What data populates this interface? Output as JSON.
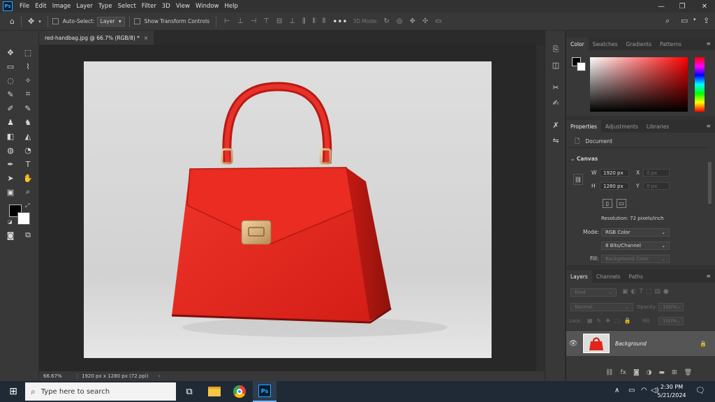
{
  "app": {
    "logo": "Ps"
  },
  "menu": [
    "File",
    "Edit",
    "Image",
    "Layer",
    "Type",
    "Select",
    "Filter",
    "3D",
    "View",
    "Window",
    "Help"
  ],
  "window_controls": {
    "minimize": "—",
    "restore": "❐",
    "close": "✕"
  },
  "options_bar": {
    "auto_select_label": "Auto-Select:",
    "auto_select_value": "Layer",
    "show_transform_label": "Show Transform Controls",
    "mode_3d_label": "3D Mode:"
  },
  "document": {
    "tab_title": "red-handbag.jpg @ 66.7% (RGB/8) *",
    "close_glyph": "×",
    "zoom": "66.67%",
    "doc_info": "1920 px x 1280 px (72 ppi)",
    "status_arrow": "›"
  },
  "color_panel": {
    "tabs": [
      "Color",
      "Swatches",
      "Gradients",
      "Patterns"
    ],
    "active": "Color"
  },
  "properties_panel": {
    "tabs": [
      "Properties",
      "Adjustments",
      "Libraries"
    ],
    "active": "Properties",
    "doc_label": "Document",
    "canvas_label": "Canvas",
    "w_label": "W",
    "w_value": "1920 px",
    "h_label": "H",
    "h_value": "1280 px",
    "x_label": "X",
    "x_value": "0 px",
    "y_label": "Y",
    "y_value": "0 px",
    "resolution": "Resolution: 72 pixels/inch",
    "mode_label": "Mode:",
    "mode_value": "RGB Color",
    "depth_value": "8 Bits/Channel",
    "fill_label": "Fill:",
    "fill_value": "Background Color"
  },
  "layers_panel": {
    "tabs": [
      "Layers",
      "Channels",
      "Paths"
    ],
    "active": "Layers",
    "filter_placeholder": "Kind",
    "blend_mode": "Normal",
    "opacity_label": "Opacity:",
    "opacity_value": "100%",
    "lock_label": "Lock:",
    "fill_label": "Fill:",
    "fill_value": "100%",
    "layer_name": "Background"
  },
  "taskbar": {
    "search_placeholder": "Type here to search",
    "time": "2:30 PM",
    "date": "5/21/2024",
    "ps_label": "Ps"
  },
  "colors": {
    "accent": "#31a8ff",
    "bag_red": "#e3241b",
    "hardware_gold": "#d9b27a"
  }
}
